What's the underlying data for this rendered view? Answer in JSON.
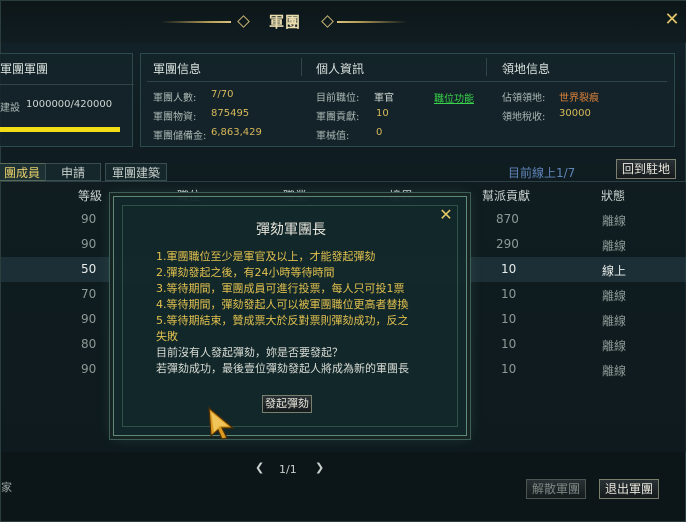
{
  "window": {
    "title": "軍團"
  },
  "left_panel": {
    "title": "軍團軍團",
    "build_label": "建設",
    "build_value": "1000000/420000",
    "build_progress": 1.0
  },
  "guild_info": {
    "title": "軍團信息",
    "members_label": "軍團人數:",
    "members_value": "7/70",
    "supplies_label": "軍團物資:",
    "supplies_value": "875495",
    "reserve_label": "軍團儲備金:",
    "reserve_value": "6,863,429"
  },
  "personal_info": {
    "title": "個人資訊",
    "position_label": "目前職位:",
    "position_value": "軍官",
    "position_link": "職位功能",
    "contribution_label": "軍團貢獻:",
    "contribution_value": "10",
    "weapon_label": "軍械值:",
    "weapon_value": "0"
  },
  "territory_info": {
    "title": "領地信息",
    "occupied_label": "佔領領地:",
    "occupied_value": "世界裂痕",
    "tax_label": "領地稅收:",
    "tax_value": "30000"
  },
  "tabs": [
    {
      "label": "團成員"
    },
    {
      "label": "申請"
    },
    {
      "label": "軍團建築"
    }
  ],
  "online_status": "目前線上1/7",
  "return_button": "回到駐地",
  "table": {
    "headers": {
      "level": "等級",
      "post": "職位",
      "job": "職業",
      "realm": "境界",
      "contribution": "幫派貢獻",
      "status": "狀態"
    },
    "rows": [
      {
        "level": "90",
        "contribution": "870",
        "status": "離線"
      },
      {
        "level": "90",
        "contribution": "290",
        "status": "離線"
      },
      {
        "level": "50",
        "contribution": "10",
        "status": "線上"
      },
      {
        "level": "70",
        "contribution": "10",
        "status": "離線"
      },
      {
        "level": "90",
        "contribution": "10",
        "status": "離線"
      },
      {
        "level": "80",
        "contribution": "10",
        "status": "離線"
      },
      {
        "level": "90",
        "contribution": "10",
        "status": "離線"
      }
    ]
  },
  "pager": {
    "text": "1/1"
  },
  "bottom": {
    "disband_button": "解散軍團",
    "leave_button": "退出軍團",
    "left_fragment": "家"
  },
  "modal": {
    "title": "彈劾軍團長",
    "rules": [
      "1.軍團職位至少是軍官及以上，才能發起彈劾",
      "2.彈劾發起之後，有24小時等待時間",
      "3.等待期間，軍團成員可進行投票，每人只可投1票",
      "4.等待期間，彈劾發起人可以被軍團職位更高者替換",
      "5.等待期結束，贊成票大於反對票則彈劾成功，反之",
      "失敗"
    ],
    "notes": [
      "目前沒有人發起彈劾，妳是否要發起？",
      "若彈劾成功，最後壹位彈劾發起人將成為新的軍團長"
    ],
    "start_button": "發起彈劾"
  }
}
